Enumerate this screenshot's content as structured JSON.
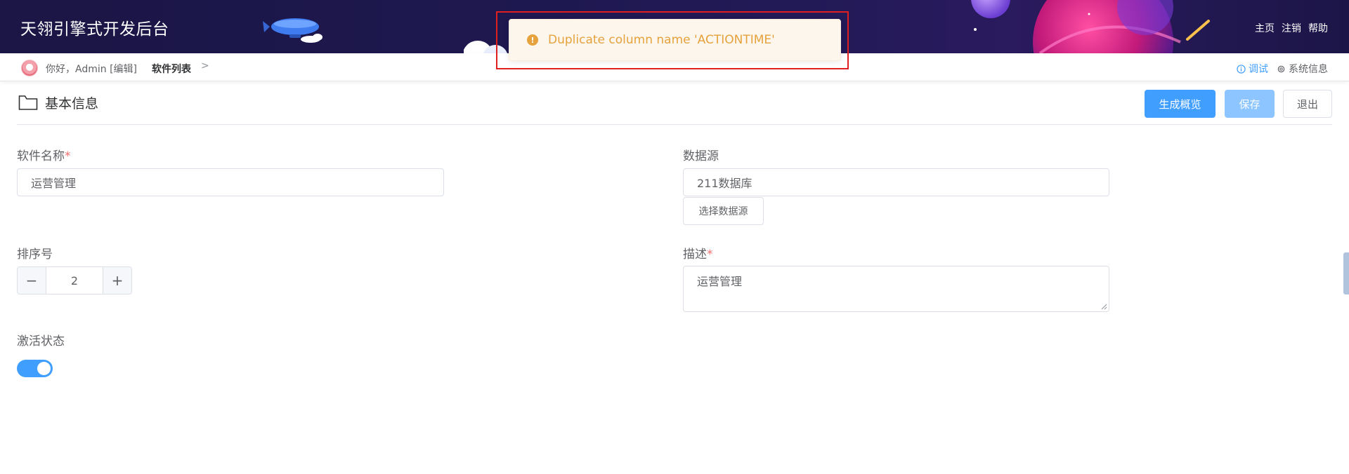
{
  "app": {
    "title": "天翎引擎式开发后台"
  },
  "top_links": [
    "主页",
    "注销",
    "帮助"
  ],
  "subbar": {
    "greeting": "你好，Admin [编辑]",
    "breadcrumb": "软件列表",
    "breadcrumb_sep": ">",
    "debug_label": "调试",
    "sysinfo_label": "系统信息"
  },
  "toast": {
    "message": "Duplicate column name 'ACTIONTIME'",
    "type": "warning",
    "color": "#e6a23c"
  },
  "section": {
    "title": "基本信息",
    "buttons": {
      "generate": "生成概览",
      "save": "保存",
      "exit": "退出"
    }
  },
  "form": {
    "software_name": {
      "label": "软件名称",
      "required_mark": "*",
      "value": "运营管理"
    },
    "datasource": {
      "label": "数据源",
      "value": "211数据库",
      "select_button": "选择数据源"
    },
    "sort_order": {
      "label": "排序号",
      "value": "2",
      "minus": "−",
      "plus": "+"
    },
    "description": {
      "label": "描述",
      "required_mark": "*",
      "value": "运营管理"
    },
    "active": {
      "label": "激活状态",
      "checked": true
    }
  },
  "colors": {
    "primary": "#409eff",
    "primary_light": "#8cc5ff",
    "banner": "#1e1850",
    "highlight": "#e02020"
  }
}
